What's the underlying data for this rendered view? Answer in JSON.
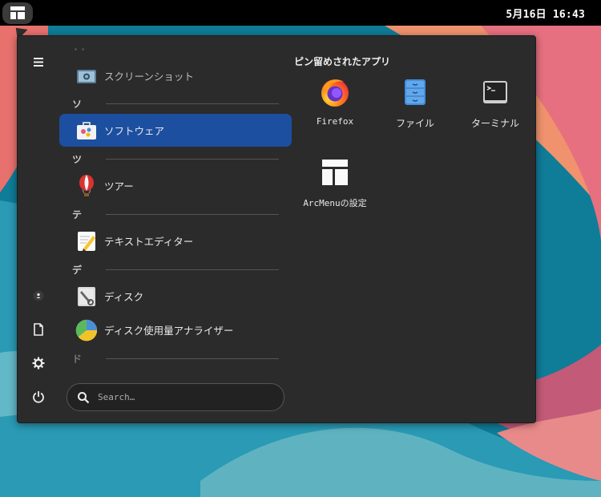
{
  "topbar": {
    "clock": "5月16日  16:43"
  },
  "sidebar": {
    "items": [
      {
        "name": "menu-icon"
      },
      {
        "name": "user-icon"
      },
      {
        "name": "document-icon"
      },
      {
        "name": "gear-icon"
      },
      {
        "name": "power-icon"
      }
    ]
  },
  "app_list": {
    "sections": [
      {
        "header": "・・",
        "apps": [
          {
            "label": "スクリーンショット",
            "icon": "screenshot-icon"
          }
        ]
      },
      {
        "header": "ソ",
        "apps": [
          {
            "label": "ソフトウェア",
            "icon": "software-icon",
            "active": true
          }
        ]
      },
      {
        "header": "ツ",
        "apps": [
          {
            "label": "ツアー",
            "icon": "balloon-icon"
          }
        ]
      },
      {
        "header": "テ",
        "apps": [
          {
            "label": "テキストエディター",
            "icon": "text-editor-icon"
          }
        ]
      },
      {
        "header": "デ",
        "apps": [
          {
            "label": "ディスク",
            "icon": "disk-icon"
          },
          {
            "label": "ディスク使用量アナライザー",
            "icon": "disk-usage-icon"
          }
        ]
      },
      {
        "header": "ド",
        "apps": []
      }
    ]
  },
  "search": {
    "placeholder": "Search…"
  },
  "pinned": {
    "title": "ピン留めされたアプリ",
    "apps": [
      {
        "label": "Firefox",
        "icon": "firefox-icon"
      },
      {
        "label": "ファイル",
        "icon": "files-icon"
      },
      {
        "label": "ターミナル",
        "icon": "terminal-icon"
      },
      {
        "label": "ArcMenuの設定",
        "icon": "arcmenu-settings-icon"
      }
    ]
  },
  "colors": {
    "accent": "#1c4fa0",
    "menu_bg": "#2b2b2b",
    "topbar": "#000000"
  }
}
